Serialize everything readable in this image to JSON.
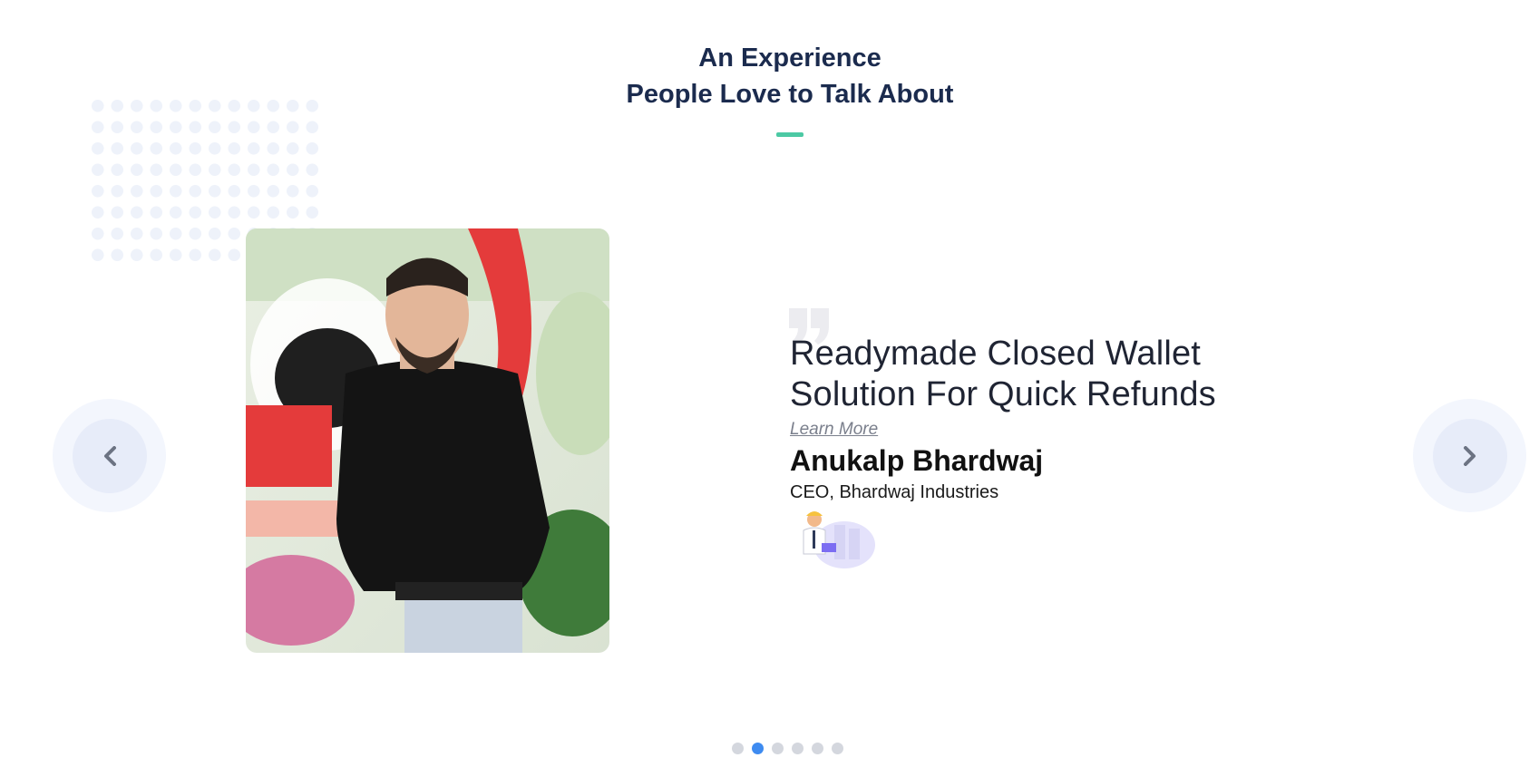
{
  "section": {
    "title_line1": "An Experience",
    "title_line2": "People Love to Talk About"
  },
  "testimonial": {
    "headline_line1": "Readymade Closed Wallet",
    "headline_line2": "Solution For Quick Refunds",
    "learn_more": "Learn More",
    "name": "Anukalp Bhardwaj",
    "role": "CEO, Bhardwaj Industries"
  },
  "carousel": {
    "prev_icon": "chevron-left-icon",
    "next_icon": "chevron-right-icon",
    "slide_count": 6,
    "active_slide": 2
  },
  "colors": {
    "title": "#1b2b4e",
    "accent": "#4cc9a4",
    "active_dot": "#3e8bf0"
  }
}
